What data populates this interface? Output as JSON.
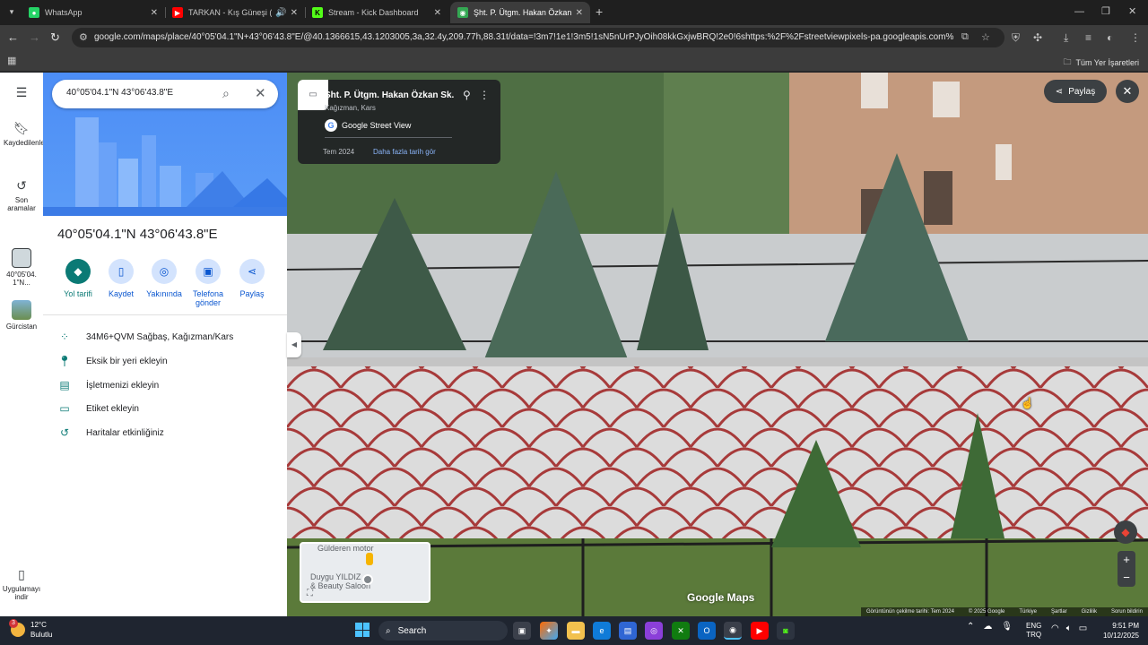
{
  "browser": {
    "tabs": [
      {
        "title": "WhatsApp",
        "icon": "whatsapp-icon",
        "color": "#25d366"
      },
      {
        "title": "TARKAN - Kış Güneşi (Offici",
        "icon": "youtube-icon",
        "color": "#ff0000"
      },
      {
        "title": "Stream - Kick Dashboard",
        "icon": "kick-icon",
        "color": "#53fc18"
      },
      {
        "title": "Şht. P. Ütgm. Hakan Özkan Sk.",
        "icon": "maps-icon",
        "color": "#34a853"
      }
    ],
    "url": "google.com/maps/place/40°05'04.1\"N+43°06'43.8\"E/@40.1366615,43.1203005,3a,32.4y,209.77h,88.31t/data=!3m7!1e1!3m5!1sN5nUrPJyOih08kkGxjwBRQ!2e0!6shttps:%2F%2Fstreetviewpixels-pa.googleapis.com%2Fv1%2Fthumbnail...",
    "bookmarks_label": "Tüm Yer İşaretleri"
  },
  "rail": {
    "saved": "Kaydedilenler",
    "recent": "Son aramalar",
    "coords_short": "40°05'04.1\"N...",
    "georgia": "Gürcistan",
    "get_app": "Uygulamayı indir"
  },
  "panel": {
    "search_value": "40°05'04.1\"N 43°06'43.8\"E",
    "title": "40°05'04.1\"N 43°06'43.8\"E",
    "actions": [
      {
        "label": "Yol tarifi",
        "icon": "directions-icon"
      },
      {
        "label": "Kaydet",
        "icon": "bookmark-icon"
      },
      {
        "label": "Yakınında",
        "icon": "nearby-icon"
      },
      {
        "label": "Telefona gönder",
        "icon": "phone-icon"
      },
      {
        "label": "Paylaş",
        "icon": "share-icon"
      }
    ],
    "rows": [
      {
        "text": "34M6+QVM Sağbaş, Kağızman/Kars",
        "icon": "plus-code-icon"
      },
      {
        "text": "Eksik bir yeri ekleyin",
        "icon": "add-place-icon"
      },
      {
        "text": "İşletmenizi ekleyin",
        "icon": "business-icon"
      },
      {
        "text": "Etiket ekleyin",
        "icon": "label-icon"
      },
      {
        "text": "Haritalar etkinliğiniz",
        "icon": "history-icon"
      }
    ]
  },
  "streetview": {
    "street": "Şht. P. Ütgm. Hakan Özkan Sk.",
    "city": "Kağızman, Kars",
    "brand": "Google Street View",
    "date": "Tem 2024",
    "more_dates": "Daha fazla tarih gör",
    "share": "Paylaş",
    "maps_brand": "Google Maps",
    "footer": {
      "capture": "Görüntünün çekilme tarihi: Tem 2024",
      "copyright": "© 2025 Google",
      "country": "Türkiye",
      "terms": "Şartlar",
      "privacy": "Gizlilik",
      "report": "Sorun bildirin"
    },
    "minimap": {
      "label1": "Gülderen motor",
      "label2": "Duygu YILDIZ",
      "label3": "& Beauty Saloon"
    }
  },
  "taskbar": {
    "temp": "12°C",
    "weather": "Bulutlu",
    "weather_badge": "3",
    "search": "Search",
    "lang1": "ENG",
    "lang2": "TRQ",
    "time": "9:51 PM",
    "date": "10/12/2025"
  }
}
